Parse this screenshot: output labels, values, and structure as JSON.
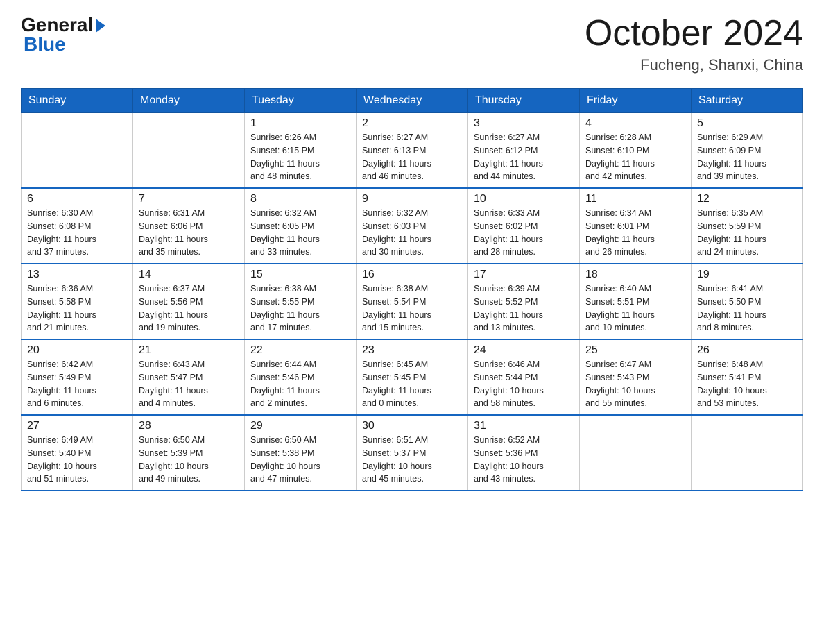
{
  "logo": {
    "general": "General",
    "blue": "Blue"
  },
  "title": "October 2024",
  "location": "Fucheng, Shanxi, China",
  "days_of_week": [
    "Sunday",
    "Monday",
    "Tuesday",
    "Wednesday",
    "Thursday",
    "Friday",
    "Saturday"
  ],
  "weeks": [
    [
      {
        "num": "",
        "info": ""
      },
      {
        "num": "",
        "info": ""
      },
      {
        "num": "1",
        "info": "Sunrise: 6:26 AM\nSunset: 6:15 PM\nDaylight: 11 hours\nand 48 minutes."
      },
      {
        "num": "2",
        "info": "Sunrise: 6:27 AM\nSunset: 6:13 PM\nDaylight: 11 hours\nand 46 minutes."
      },
      {
        "num": "3",
        "info": "Sunrise: 6:27 AM\nSunset: 6:12 PM\nDaylight: 11 hours\nand 44 minutes."
      },
      {
        "num": "4",
        "info": "Sunrise: 6:28 AM\nSunset: 6:10 PM\nDaylight: 11 hours\nand 42 minutes."
      },
      {
        "num": "5",
        "info": "Sunrise: 6:29 AM\nSunset: 6:09 PM\nDaylight: 11 hours\nand 39 minutes."
      }
    ],
    [
      {
        "num": "6",
        "info": "Sunrise: 6:30 AM\nSunset: 6:08 PM\nDaylight: 11 hours\nand 37 minutes."
      },
      {
        "num": "7",
        "info": "Sunrise: 6:31 AM\nSunset: 6:06 PM\nDaylight: 11 hours\nand 35 minutes."
      },
      {
        "num": "8",
        "info": "Sunrise: 6:32 AM\nSunset: 6:05 PM\nDaylight: 11 hours\nand 33 minutes."
      },
      {
        "num": "9",
        "info": "Sunrise: 6:32 AM\nSunset: 6:03 PM\nDaylight: 11 hours\nand 30 minutes."
      },
      {
        "num": "10",
        "info": "Sunrise: 6:33 AM\nSunset: 6:02 PM\nDaylight: 11 hours\nand 28 minutes."
      },
      {
        "num": "11",
        "info": "Sunrise: 6:34 AM\nSunset: 6:01 PM\nDaylight: 11 hours\nand 26 minutes."
      },
      {
        "num": "12",
        "info": "Sunrise: 6:35 AM\nSunset: 5:59 PM\nDaylight: 11 hours\nand 24 minutes."
      }
    ],
    [
      {
        "num": "13",
        "info": "Sunrise: 6:36 AM\nSunset: 5:58 PM\nDaylight: 11 hours\nand 21 minutes."
      },
      {
        "num": "14",
        "info": "Sunrise: 6:37 AM\nSunset: 5:56 PM\nDaylight: 11 hours\nand 19 minutes."
      },
      {
        "num": "15",
        "info": "Sunrise: 6:38 AM\nSunset: 5:55 PM\nDaylight: 11 hours\nand 17 minutes."
      },
      {
        "num": "16",
        "info": "Sunrise: 6:38 AM\nSunset: 5:54 PM\nDaylight: 11 hours\nand 15 minutes."
      },
      {
        "num": "17",
        "info": "Sunrise: 6:39 AM\nSunset: 5:52 PM\nDaylight: 11 hours\nand 13 minutes."
      },
      {
        "num": "18",
        "info": "Sunrise: 6:40 AM\nSunset: 5:51 PM\nDaylight: 11 hours\nand 10 minutes."
      },
      {
        "num": "19",
        "info": "Sunrise: 6:41 AM\nSunset: 5:50 PM\nDaylight: 11 hours\nand 8 minutes."
      }
    ],
    [
      {
        "num": "20",
        "info": "Sunrise: 6:42 AM\nSunset: 5:49 PM\nDaylight: 11 hours\nand 6 minutes."
      },
      {
        "num": "21",
        "info": "Sunrise: 6:43 AM\nSunset: 5:47 PM\nDaylight: 11 hours\nand 4 minutes."
      },
      {
        "num": "22",
        "info": "Sunrise: 6:44 AM\nSunset: 5:46 PM\nDaylight: 11 hours\nand 2 minutes."
      },
      {
        "num": "23",
        "info": "Sunrise: 6:45 AM\nSunset: 5:45 PM\nDaylight: 11 hours\nand 0 minutes."
      },
      {
        "num": "24",
        "info": "Sunrise: 6:46 AM\nSunset: 5:44 PM\nDaylight: 10 hours\nand 58 minutes."
      },
      {
        "num": "25",
        "info": "Sunrise: 6:47 AM\nSunset: 5:43 PM\nDaylight: 10 hours\nand 55 minutes."
      },
      {
        "num": "26",
        "info": "Sunrise: 6:48 AM\nSunset: 5:41 PM\nDaylight: 10 hours\nand 53 minutes."
      }
    ],
    [
      {
        "num": "27",
        "info": "Sunrise: 6:49 AM\nSunset: 5:40 PM\nDaylight: 10 hours\nand 51 minutes."
      },
      {
        "num": "28",
        "info": "Sunrise: 6:50 AM\nSunset: 5:39 PM\nDaylight: 10 hours\nand 49 minutes."
      },
      {
        "num": "29",
        "info": "Sunrise: 6:50 AM\nSunset: 5:38 PM\nDaylight: 10 hours\nand 47 minutes."
      },
      {
        "num": "30",
        "info": "Sunrise: 6:51 AM\nSunset: 5:37 PM\nDaylight: 10 hours\nand 45 minutes."
      },
      {
        "num": "31",
        "info": "Sunrise: 6:52 AM\nSunset: 5:36 PM\nDaylight: 10 hours\nand 43 minutes."
      },
      {
        "num": "",
        "info": ""
      },
      {
        "num": "",
        "info": ""
      }
    ]
  ]
}
